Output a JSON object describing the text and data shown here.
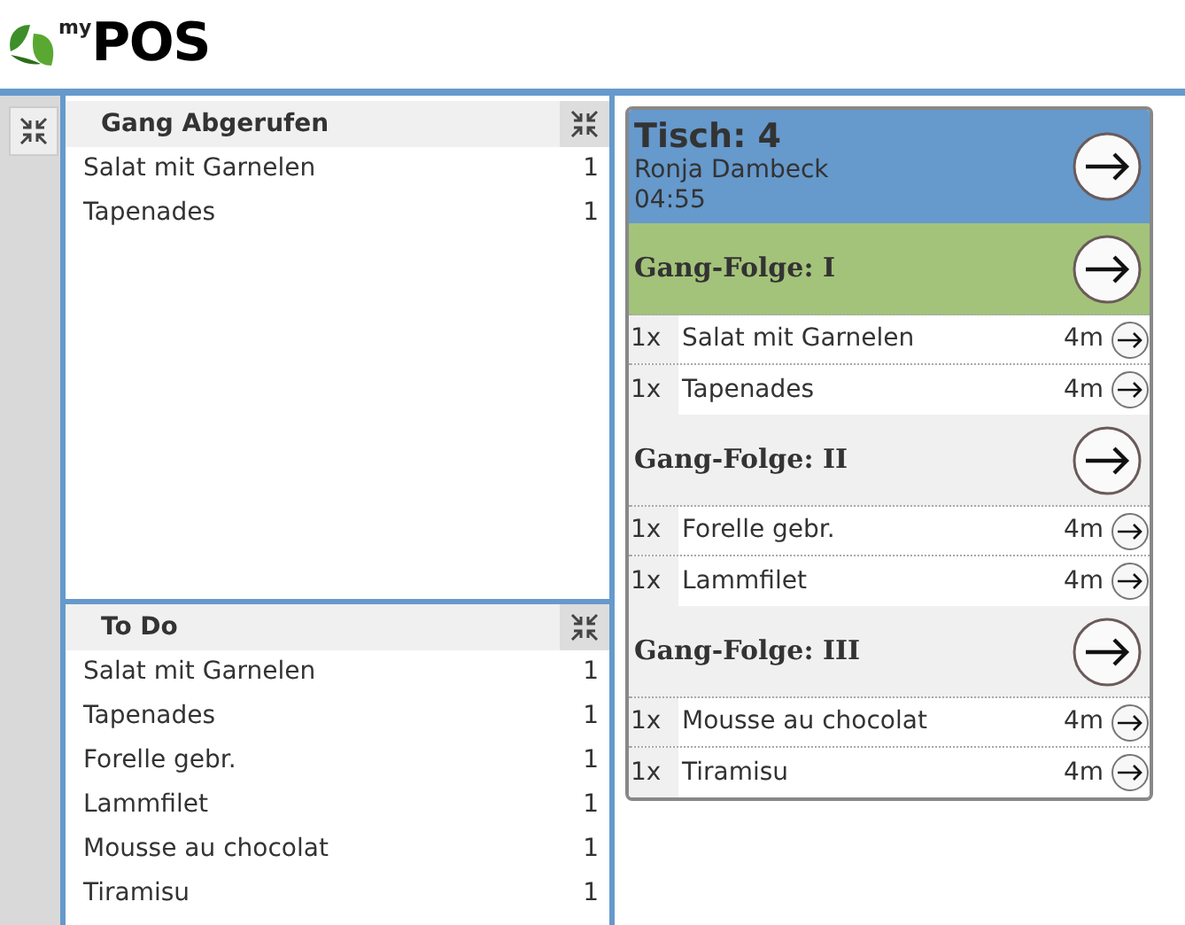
{
  "logo": {
    "prefix": "my",
    "name": "POS"
  },
  "sections": [
    {
      "title": "Gang Abgerufen",
      "items": [
        {
          "name": "Salat mit Garnelen",
          "count": "1"
        },
        {
          "name": "Tapenades",
          "count": "1"
        }
      ]
    },
    {
      "title": "To Do",
      "items": [
        {
          "name": "Salat mit Garnelen",
          "count": "1"
        },
        {
          "name": "Tapenades",
          "count": "1"
        },
        {
          "name": "Forelle gebr.",
          "count": "1"
        },
        {
          "name": "Lammfilet",
          "count": "1"
        },
        {
          "name": "Mousse au chocolat",
          "count": "1"
        },
        {
          "name": "Tiramisu",
          "count": "1"
        }
      ]
    }
  ],
  "order": {
    "table": "Tisch: 4",
    "guest": "Ronja Dambeck",
    "time": "04:55",
    "courses": [
      {
        "title": "Gang-Folge: I",
        "active": true,
        "items": [
          {
            "qty": "1x",
            "name": "Salat mit Garnelen",
            "wait": "4m"
          },
          {
            "qty": "1x",
            "name": "Tapenades",
            "wait": "4m"
          }
        ]
      },
      {
        "title": "Gang-Folge: II",
        "active": false,
        "items": [
          {
            "qty": "1x",
            "name": "Forelle gebr.",
            "wait": "4m"
          },
          {
            "qty": "1x",
            "name": "Lammfilet",
            "wait": "4m"
          }
        ]
      },
      {
        "title": "Gang-Folge: III",
        "active": false,
        "items": [
          {
            "qty": "1x",
            "name": "Mousse au chocolat",
            "wait": "4m"
          },
          {
            "qty": "1x",
            "name": "Tiramisu",
            "wait": "4m"
          }
        ]
      }
    ]
  }
}
